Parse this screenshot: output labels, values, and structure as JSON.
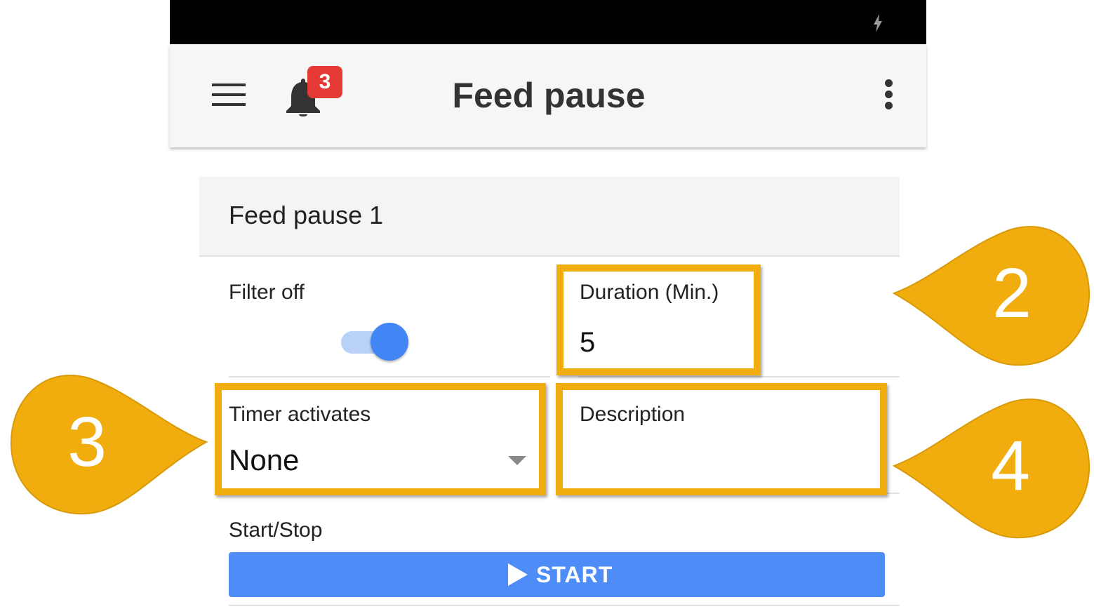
{
  "status_bar": {
    "icon": "charging-bolt-icon"
  },
  "app_bar": {
    "title": "Feed pause",
    "notification_count": "3",
    "menu_icon": "hamburger-menu-icon",
    "bell_icon": "bell-icon",
    "more_icon": "more-vert-icon"
  },
  "card": {
    "title": "Feed pause 1",
    "filter_label": "Filter off",
    "filter_toggle_on": true,
    "duration_label": "Duration (Min.)",
    "duration_value": "5",
    "timer_label": "Timer activates",
    "timer_value": "None",
    "description_label": "Description",
    "description_value": "",
    "start_stop_label": "Start/Stop",
    "start_button_label": "START"
  },
  "annotations": {
    "color": "#f0ad0d",
    "callouts": [
      "2",
      "3",
      "4"
    ]
  },
  "colors": {
    "accent": "#4285f4",
    "button": "#4e8cf7",
    "badge": "#e53935"
  }
}
